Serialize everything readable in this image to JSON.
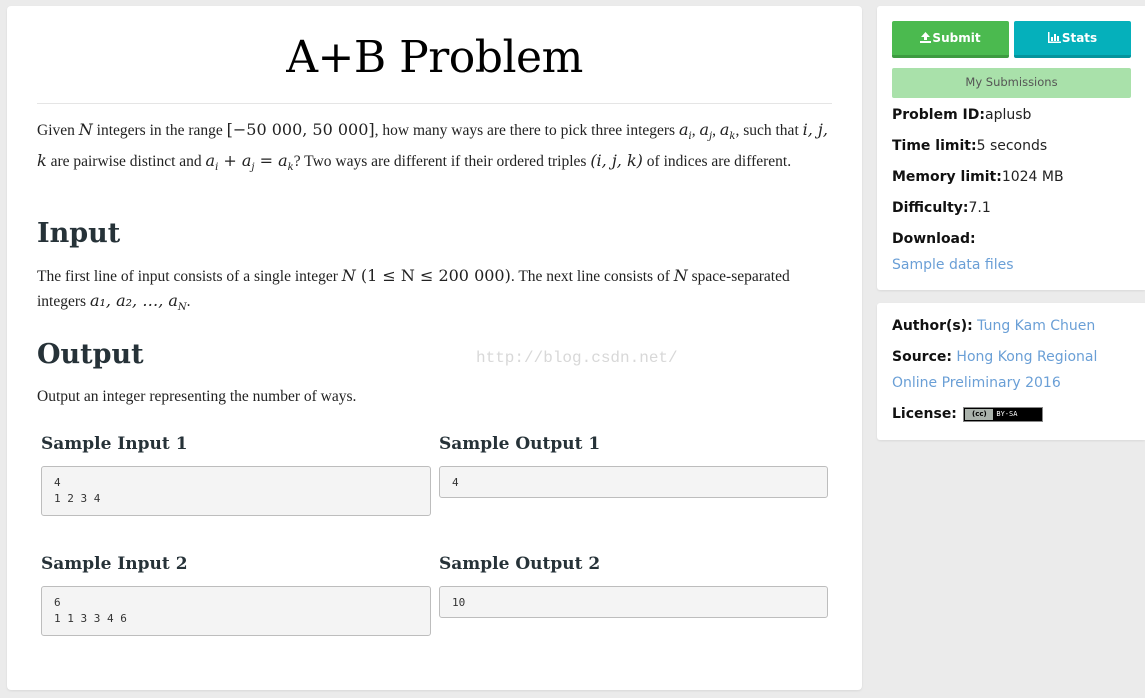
{
  "problem": {
    "title": "A+B Problem",
    "statement": {
      "t1": "Given ",
      "m1": "N",
      "t2": " integers in the range ",
      "m2": "[−50 000, 50 000]",
      "t3": ", how many ways are there to pick three integers ",
      "m3": "a",
      "m3s": "i",
      "t4": ", ",
      "m4": "a",
      "m4s": "j",
      "t5": ", ",
      "m5": "a",
      "m5s": "k",
      "t6": ", such that ",
      "m6": "i, j, k",
      "t7": " are pairwise distinct and ",
      "m7": "a",
      "m7s": "i",
      "m7b": " + a",
      "m7bs": "j",
      "m7c": " = a",
      "m7cs": "k",
      "t8": "? Two ways are different if their ordered triples ",
      "m8": "(i, j, k)",
      "t9": " of indices are different."
    },
    "input_heading": "Input",
    "input_text": {
      "t1": "The first line of input consists of a single integer ",
      "m1": "N",
      "m2": " (1 ≤ N ≤ 200 000)",
      "t2": ". The next line consists of ",
      "m3": "N",
      "t3": " space-separated integers ",
      "m4": "a₁, a₂, …, a",
      "m4s": "N",
      "t4": "."
    },
    "output_heading": "Output",
    "output_text": "Output an integer representing the number of ways.",
    "watermark": "http://blog.csdn.net/",
    "samples": [
      {
        "input_label": "Sample Input 1",
        "input": "4\n1 2 3 4",
        "output_label": "Sample Output 1",
        "output": "4"
      },
      {
        "input_label": "Sample Input 2",
        "input": "6\n1 1 3 3 4 6",
        "output_label": "Sample Output 2",
        "output": "10"
      }
    ]
  },
  "sidebar": {
    "buttons": {
      "submit": {
        "label": "Submit",
        "icon": "upload-icon",
        "color": "#4bba4f"
      },
      "stats": {
        "label": "Stats",
        "icon": "bar-chart-icon",
        "color": "#05b0bb"
      },
      "my_submissions": {
        "label": "My Submissions",
        "color": "#a9e1aa"
      }
    },
    "info": {
      "problem_id_label": "Problem ID:",
      "problem_id": "aplusb",
      "time_limit_label": "Time limit:",
      "time_limit": "5 seconds",
      "memory_limit_label": "Memory limit:",
      "memory_limit": "1024 MB",
      "difficulty_label": "Difficulty:",
      "difficulty": "7.1",
      "download_label": "Download:",
      "download_link": "Sample data files"
    },
    "meta": {
      "author_label": "Author(s):",
      "author": "Tung Kam Chuen",
      "source_label": "Source:",
      "source_line1": "Hong Kong Regional",
      "source_line2": "Online Preliminary 2016",
      "license_label": "License:",
      "license_cc": "(cc)",
      "license_type": "BY-SA"
    },
    "link_color": "#6a9fd6"
  }
}
